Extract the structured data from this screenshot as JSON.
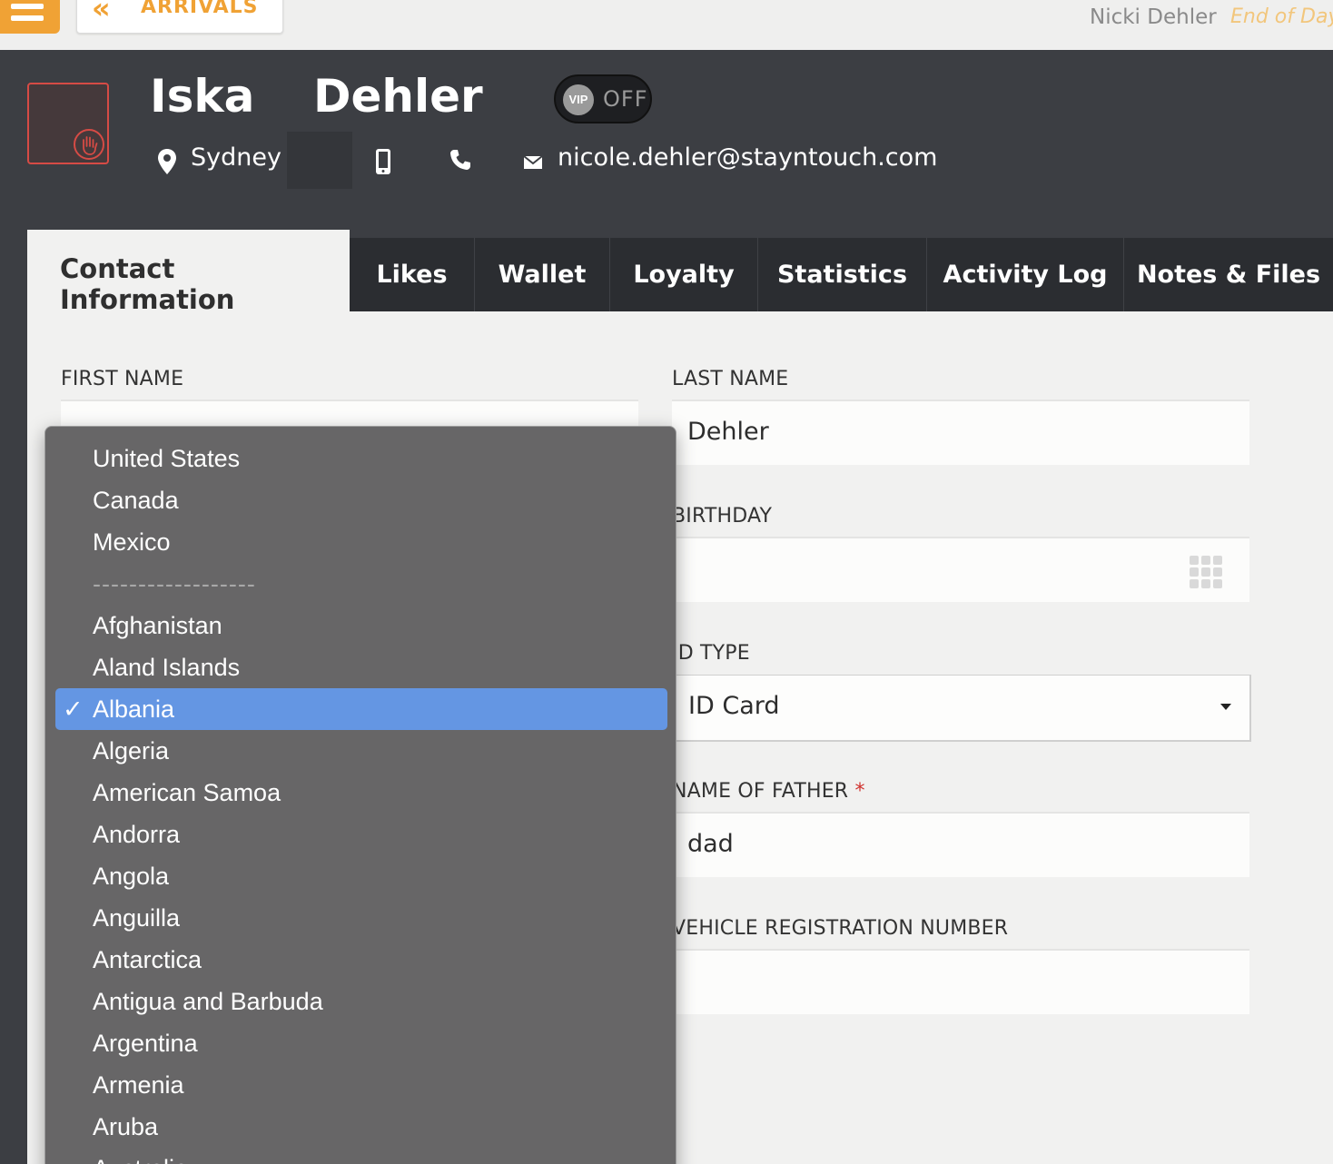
{
  "topbar": {
    "arrivals_label": "ARRIVALS",
    "user_name": "Nicki Dehler",
    "end_of_day": "End of Day"
  },
  "guest": {
    "first_name": "Iska",
    "last_name": "Dehler",
    "vip_badge": "VIP",
    "vip_state": "OFF",
    "city": "Sydney",
    "email": "nicole.dehler@stayntouch.com"
  },
  "tabs": [
    {
      "label": "Contact Information",
      "active": true
    },
    {
      "label": "Likes"
    },
    {
      "label": "Wallet"
    },
    {
      "label": "Loyalty"
    },
    {
      "label": "Statistics"
    },
    {
      "label": "Activity Log"
    },
    {
      "label": "Notes & Files"
    }
  ],
  "form": {
    "first_name_label": "FIRST NAME",
    "last_name_label": "LAST NAME",
    "last_name_value": "Dehler",
    "birthday_label": "BIRTHDAY",
    "id_type_label": "ID TYPE",
    "id_type_value": "ID Card",
    "father_label": "NAME OF FATHER",
    "father_required": "*",
    "father_value": "dad",
    "vehicle_label": "VEHICLE REGISTRATION NUMBER"
  },
  "country_dropdown": {
    "selected": "Albania",
    "options": [
      "United States",
      "Canada",
      "Mexico",
      "------------------",
      "Afghanistan",
      "Aland Islands",
      "Albania",
      "Algeria",
      "American Samoa",
      "Andorra",
      "Angola",
      "Anguilla",
      "Antarctica",
      "Antigua and Barbuda",
      "Argentina",
      "Armenia",
      "Aruba",
      "Australia"
    ]
  },
  "colors": {
    "accent_orange": "#f0a235",
    "header_dark": "#3c3e43",
    "tab_bar": "#2b2d31",
    "selected_option": "#6496e3",
    "required_red": "#d0312d"
  },
  "icons": [
    "menu-icon",
    "double-chevron-left-icon",
    "hand-stop-icon",
    "location-pin-icon",
    "mobile-phone-icon",
    "phone-icon",
    "mail-icon",
    "calendar-grid-icon",
    "dropdown-caret-icon",
    "checkmark-icon"
  ]
}
